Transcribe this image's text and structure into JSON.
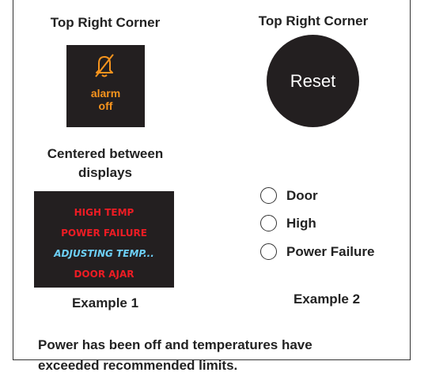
{
  "example1": {
    "corner_label": "Top Right Corner",
    "alarm_button": {
      "line1": "alarm",
      "line2": "off",
      "text_color": "#f7941d",
      "icon": "bell-slash-icon"
    },
    "centered_label_line1": "Centered between",
    "centered_label_line2": "displays",
    "display": {
      "lines": [
        {
          "text": "HIGH TEMP",
          "color": "#ed1c24",
          "italic": false
        },
        {
          "text": "POWER FAILURE",
          "color": "#ed1c24",
          "italic": false
        },
        {
          "text": "ADJUSTING TEMP...",
          "color": "#6dcff6",
          "italic": true
        },
        {
          "text": "DOOR AJAR",
          "color": "#ed1c24",
          "italic": false
        }
      ]
    },
    "caption": "Example 1"
  },
  "example2": {
    "corner_label": "Top Right Corner",
    "reset_label": "Reset",
    "options": [
      "Door",
      "High",
      "Power Failure"
    ],
    "caption": "Example 2"
  },
  "message": {
    "line1": "Power has been off and temperatures have",
    "line2": "exceeded recommended limits."
  },
  "colors": {
    "panel": "#231f20",
    "text": "#222222"
  }
}
